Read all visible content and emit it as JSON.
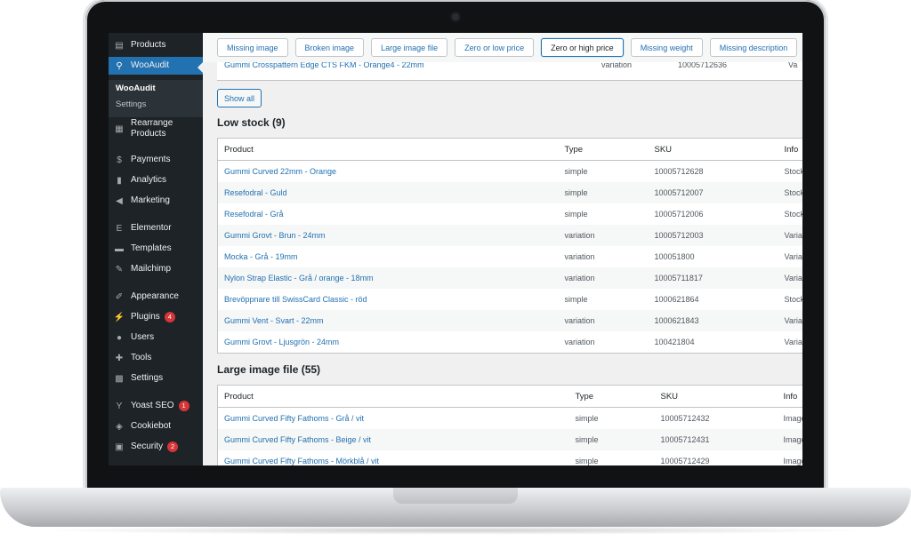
{
  "sidebar": {
    "items": [
      {
        "label": "Products",
        "icon": "products-icon"
      },
      {
        "label": "WooAudit",
        "icon": "search-icon"
      },
      {
        "label": "Rearrange Products",
        "icon": "grid-icon"
      },
      {
        "label": "Payments",
        "icon": "dollar-icon"
      },
      {
        "label": "Analytics",
        "icon": "bar-chart-icon"
      },
      {
        "label": "Marketing",
        "icon": "megaphone-icon"
      },
      {
        "label": "Elementor",
        "icon": "elementor-icon"
      },
      {
        "label": "Templates",
        "icon": "folder-icon"
      },
      {
        "label": "Mailchimp",
        "icon": "mailchimp-icon"
      },
      {
        "label": "Appearance",
        "icon": "paintbrush-icon"
      },
      {
        "label": "Plugins",
        "icon": "plug-icon",
        "badge": "4"
      },
      {
        "label": "Users",
        "icon": "user-icon"
      },
      {
        "label": "Tools",
        "icon": "wrench-icon"
      },
      {
        "label": "Settings",
        "icon": "settings-icon"
      },
      {
        "label": "Yoast SEO",
        "icon": "yoast-icon",
        "badge": "1"
      },
      {
        "label": "Cookiebot",
        "icon": "shield-icon"
      },
      {
        "label": "Security",
        "icon": "lock-icon",
        "badge": "2"
      }
    ],
    "submenu": [
      "WooAudit",
      "Settings"
    ]
  },
  "filters": [
    "Missing image",
    "Broken image",
    "Large image file",
    "Zero or low price",
    "Zero or high price",
    "Missing weight",
    "Missing description"
  ],
  "active_filter": "Zero or high price",
  "partial_row": {
    "product": "Gummi Crosspattern Edge CTS FKM - Orange4 - 22mm",
    "type": "variation",
    "sku": "10005712636",
    "info": "Va"
  },
  "show_all_label": "Show all",
  "low_stock": {
    "title": "Low stock (9)",
    "headers": [
      "Product",
      "Type",
      "SKU",
      "Info"
    ],
    "rows": [
      {
        "product": "Gummi Curved 22mm - Orange",
        "type": "simple",
        "sku": "10005712628",
        "info": "Stock"
      },
      {
        "product": "Resefodral - Guld",
        "type": "simple",
        "sku": "10005712007",
        "info": "Stock"
      },
      {
        "product": "Resefodral - Grå",
        "type": "simple",
        "sku": "10005712006",
        "info": "Stock"
      },
      {
        "product": "Gummi Grovt - Brun - 24mm",
        "type": "variation",
        "sku": "10005712003",
        "info": "Varia"
      },
      {
        "product": "Mocka - Grå - 19mm",
        "type": "variation",
        "sku": "100051800",
        "info": "Varia"
      },
      {
        "product": "Nylon Strap Elastic - Grå / orange - 18mm",
        "type": "variation",
        "sku": "10005711817",
        "info": "Varia"
      },
      {
        "product": "Brevöppnare till SwissCard Classic - röd",
        "type": "simple",
        "sku": "1000621864",
        "info": "Stock"
      },
      {
        "product": "Gummi Vent - Svart - 22mm",
        "type": "variation",
        "sku": "1000621843",
        "info": "Varia"
      },
      {
        "product": "Gummi Grovt - Ljusgrön - 24mm",
        "type": "variation",
        "sku": "100421804",
        "info": "Varia"
      }
    ]
  },
  "large_image": {
    "title": "Large image file (55)",
    "headers": [
      "Product",
      "Type",
      "SKU",
      "Info"
    ],
    "rows": [
      {
        "product": "Gummi Curved Fifty Fathoms - Grå / vit",
        "type": "simple",
        "sku": "10005712432",
        "info": "Image"
      },
      {
        "product": "Gummi Curved Fifty Fathoms - Beige / vit",
        "type": "simple",
        "sku": "10005712431",
        "info": "Image"
      },
      {
        "product": "Gummi Curved Fifty Fathoms - Mörkblå / vit",
        "type": "simple",
        "sku": "10005712429",
        "info": "Image"
      }
    ]
  }
}
